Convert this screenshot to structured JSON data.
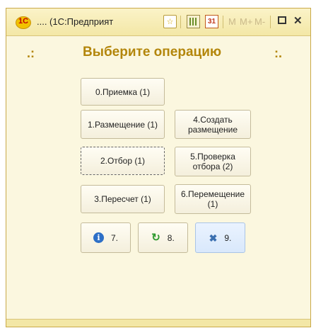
{
  "titlebar": {
    "logo_text": "1С",
    "title": ".... (1С:Предприят",
    "favorite_icon": "star-icon",
    "calc_icon": "calculator-icon",
    "calendar_icon": "calendar-icon",
    "calendar_text": "31",
    "m_label": "M",
    "mplus_label": "M+",
    "mminus_label": "M-",
    "maximize_icon": "maximize-icon",
    "close_label": "✕"
  },
  "header": {
    "left_marker": ".:",
    "title": "Выберите операцию",
    "right_marker": ":."
  },
  "operations": {
    "op0": "0.Приемка (1)",
    "op1": "1.Размещение (1)",
    "op4": "4.Создать размещение",
    "op2": "2.Отбор (1)",
    "op5": "5.Проверка отбора (2)",
    "op3": "3.Пересчет (1)",
    "op6": "6.Перемещение (1)"
  },
  "actions": [
    {
      "label": "7.",
      "icon": "info-icon"
    },
    {
      "label": "8.",
      "icon": "refresh-icon"
    },
    {
      "label": "9.",
      "icon": "close-x-icon"
    }
  ],
  "colors": {
    "window_bg": "#fbf7df",
    "heading": "#b3860b",
    "active_button": "#d9e8fb"
  }
}
